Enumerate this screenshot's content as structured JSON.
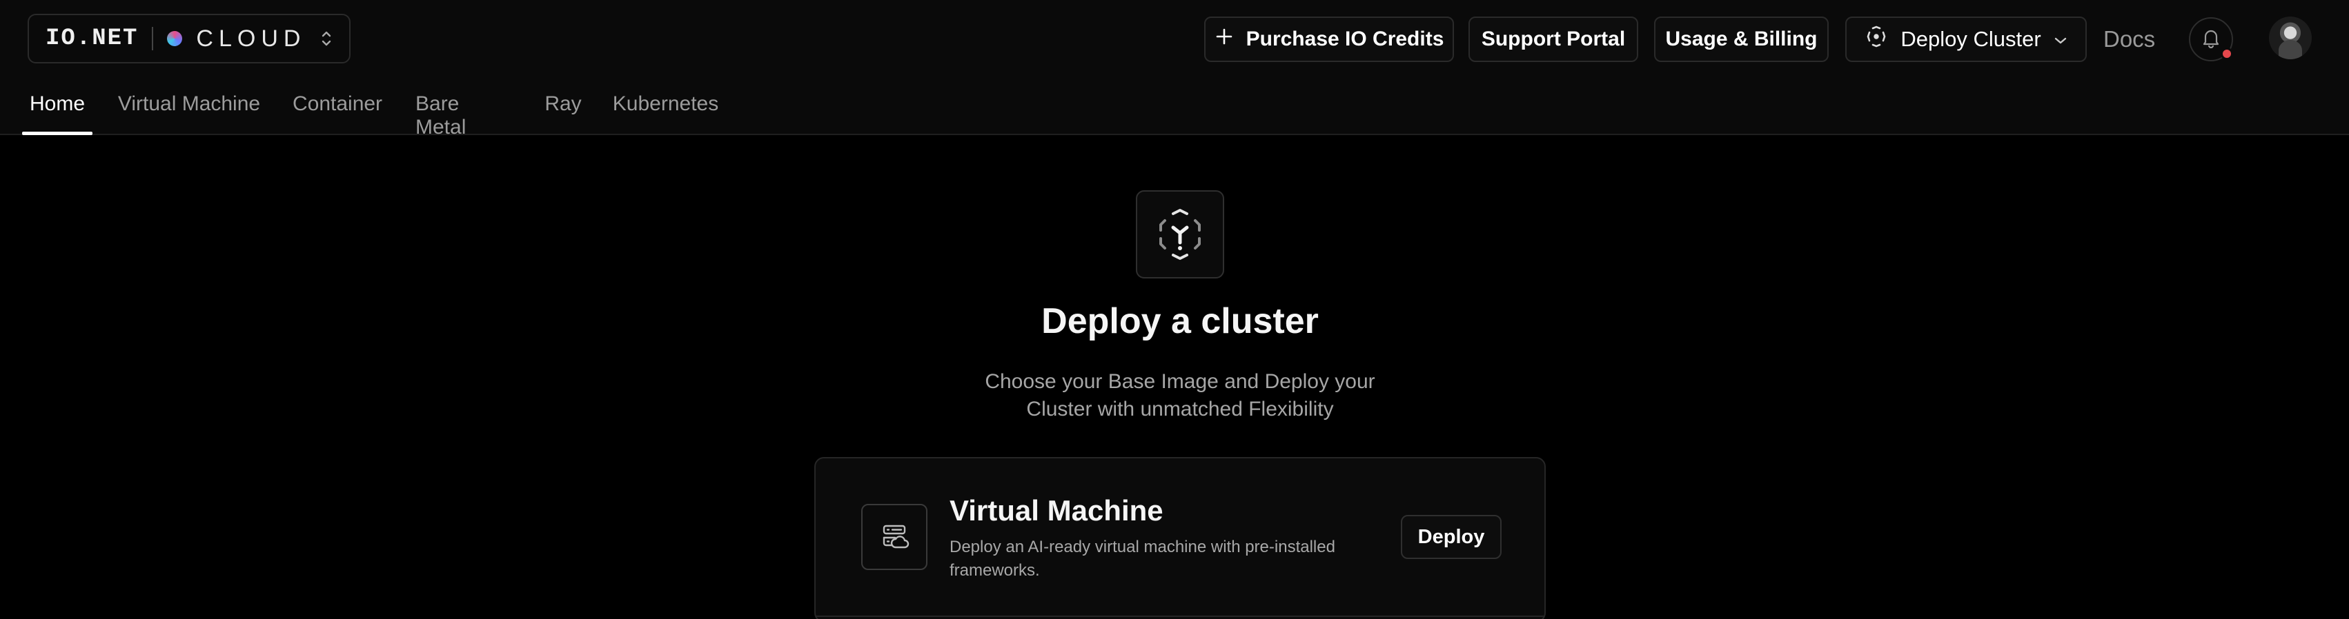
{
  "brand": {
    "logo": "IO.NET",
    "product": "CLOUD"
  },
  "header": {
    "purchase_label": "Purchase IO Credits",
    "support_label": "Support Portal",
    "billing_label": "Usage & Billing",
    "deploy_label": "Deploy Cluster",
    "docs_label": "Docs"
  },
  "tabs": [
    {
      "label": "Home",
      "active": true
    },
    {
      "label": "Virtual Machine",
      "active": false
    },
    {
      "label": "Container",
      "active": false
    },
    {
      "label": "Bare Metal",
      "active": false
    },
    {
      "label": "Ray",
      "active": false
    },
    {
      "label": "Kubernetes",
      "active": false
    }
  ],
  "hero": {
    "title": "Deploy a cluster",
    "subtitle": "Choose your Base Image and Deploy your Cluster with unmatched Flexibility"
  },
  "cards": [
    {
      "title": "Virtual Machine",
      "description": "Deploy an AI-ready virtual machine with pre-installed frameworks.",
      "button_label": "Deploy"
    }
  ],
  "colors": {
    "background": "#000000",
    "header_background": "#0a0a0a",
    "border": "#2a2a2a",
    "notification_dot": "#e5484d"
  },
  "icons": {
    "brand_switch": "chevron-up-down-icon",
    "purchase": "plus-icon",
    "deploy": "cluster-icon",
    "deploy_chevron": "chevron-down-icon",
    "notifications": "bell-icon",
    "hero": "cluster-icon",
    "vm_card": "server-icon"
  }
}
